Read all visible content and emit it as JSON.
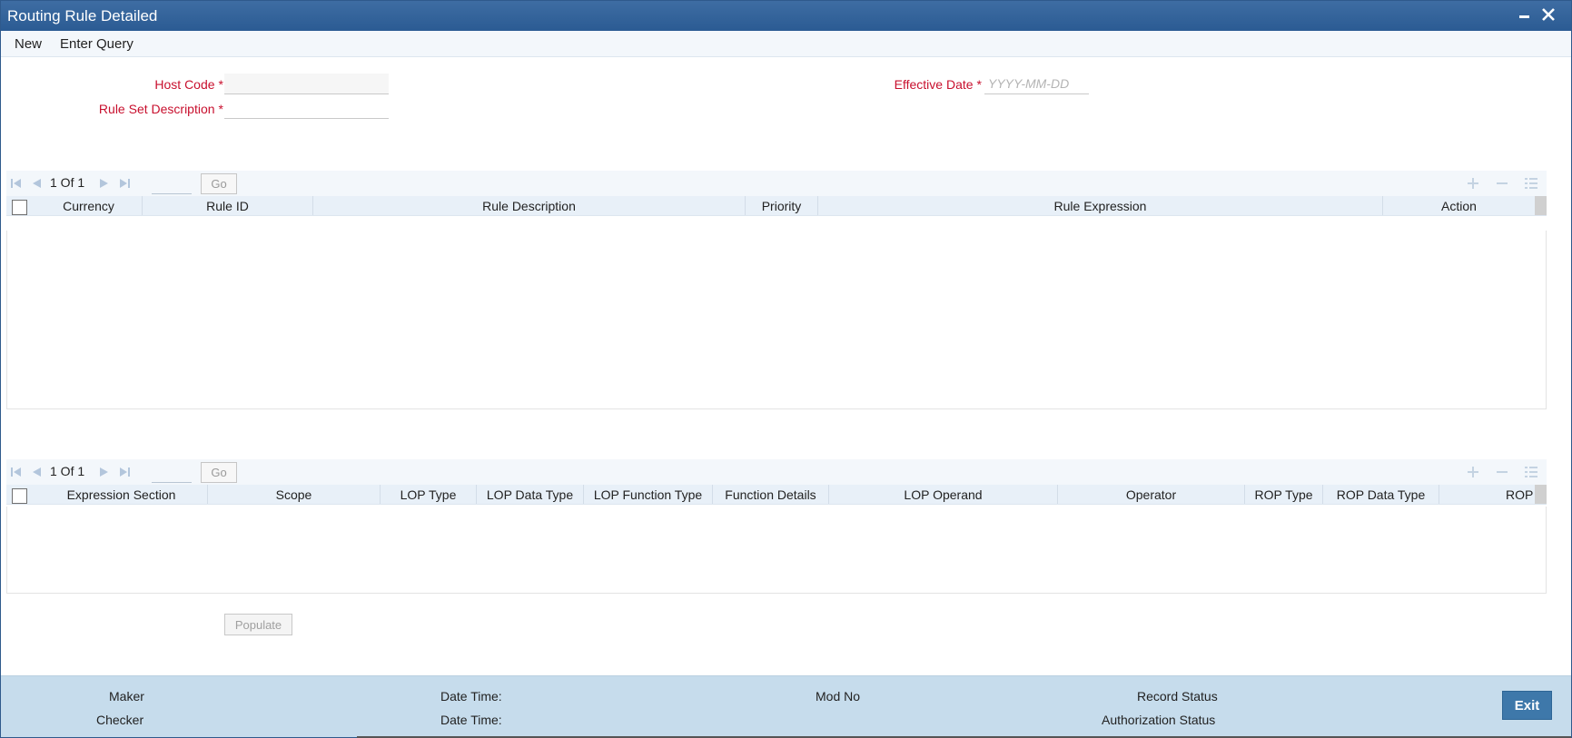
{
  "window": {
    "title": "Routing Rule Detailed"
  },
  "menu": {
    "new": "New",
    "enter_query": "Enter Query"
  },
  "form": {
    "host_code_label": "Host Code",
    "host_code_value": "",
    "rule_set_desc_label": "Rule Set Description",
    "rule_set_desc_value": "",
    "effective_date_label": "Effective Date",
    "effective_date_placeholder": "YYYY-MM-DD",
    "required_mark": "*"
  },
  "rules_grid": {
    "pager": {
      "text": "1 Of 1",
      "go": "Go"
    },
    "columns": [
      "Currency",
      "Rule ID",
      "Rule Description",
      "Priority",
      "Rule Expression",
      "Action"
    ]
  },
  "expr_grid": {
    "pager": {
      "text": "1 Of 1",
      "go": "Go"
    },
    "columns": [
      "Expression Section",
      "Scope",
      "LOP Type",
      "LOP Data Type",
      "LOP Function Type",
      "Function Details",
      "LOP Operand",
      "Operator",
      "ROP Type",
      "ROP Data Type",
      "ROP Operand"
    ]
  },
  "populate": "Populate",
  "footer": {
    "maker": "Maker",
    "checker": "Checker",
    "date_time": "Date Time:",
    "mod_no": "Mod No",
    "record_status": "Record Status",
    "authorization_status": "Authorization Status",
    "exit": "Exit"
  },
  "colors": {
    "title_bar": "#2b5b93",
    "required": "#c8102e",
    "footer": "#c6dcec",
    "exit_button": "#3e78aa"
  }
}
